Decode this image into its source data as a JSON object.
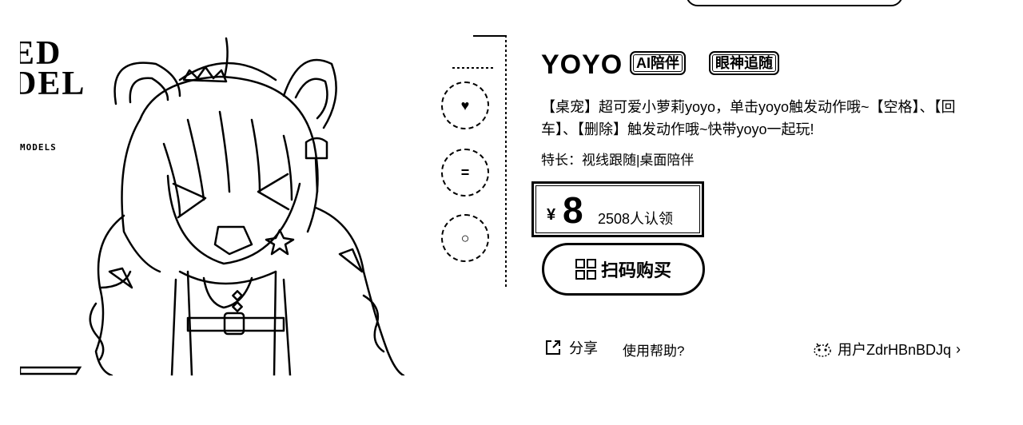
{
  "preview": {
    "brand_lines": [
      "ED",
      "DEL"
    ],
    "brand_sub": "MODELS"
  },
  "side_toolbar": {
    "buttons": [
      {
        "icon": "heart-icon",
        "glyph": "♥"
      },
      {
        "icon": "equals-icon",
        "glyph": "="
      },
      {
        "icon": "circle-icon",
        "glyph": "○"
      }
    ]
  },
  "product": {
    "name": "YOYO",
    "tags": [
      "AI陪伴",
      "眼神追随"
    ],
    "description": "【桌宠】超可爱小萝莉yoyo，单击yoyo触发动作哦~【空格】、【回车】、【删除】触发动作哦~快带yoyo一起玩!",
    "specialty": "特长：视线跟随|桌面陪伴",
    "currency": "¥",
    "price": "8",
    "claimed": "2508人认领",
    "buy_label": "扫码购买"
  },
  "footer": {
    "share_label": "分享",
    "help_label": "使用帮助?",
    "user_label": "用户ZdrHBnBDJq",
    "user_chevron": "›"
  }
}
